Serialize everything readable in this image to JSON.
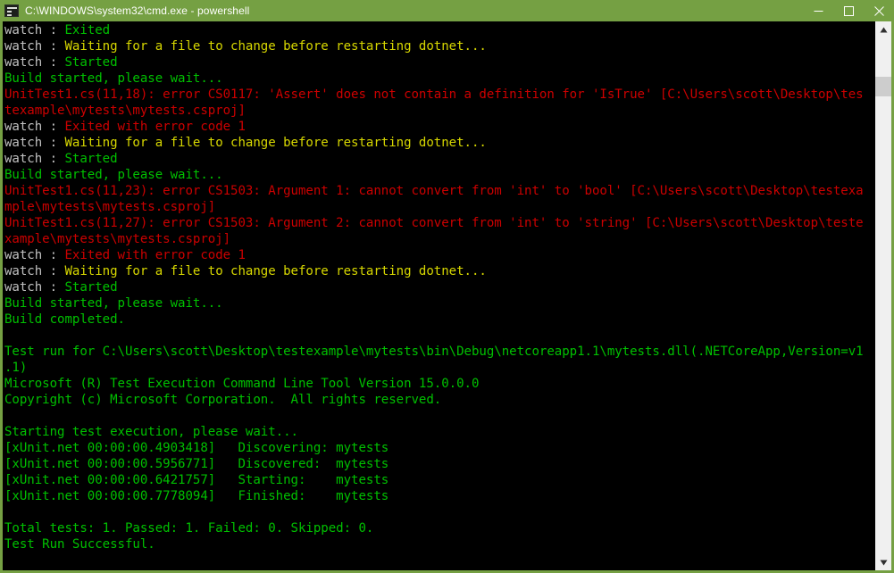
{
  "window": {
    "title": "C:\\WINDOWS\\system32\\cmd.exe - powershell",
    "icon": "cmd-console-icon",
    "titlebar_color": "#75a043",
    "console_bg": "#000000"
  },
  "controls": {
    "minimize_label": "Minimize",
    "maximize_label": "Maximize",
    "close_label": "Close"
  },
  "scrollbar": {
    "up_arrow_label": "Scroll up",
    "down_arrow_label": "Scroll down",
    "thumb_label": "Scroll thumb"
  },
  "colors": {
    "green": "#00c000",
    "red": "#cc0000",
    "yellow": "#d7d700",
    "gray": "#c0c0c0",
    "accent": "#75a043"
  },
  "console": {
    "lines": [
      [
        {
          "t": "watch : ",
          "c": "gray"
        },
        {
          "t": "Exited",
          "c": "green"
        }
      ],
      [
        {
          "t": "watch : ",
          "c": "gray"
        },
        {
          "t": "Waiting for a file to change before restarting dotnet...",
          "c": "yellow"
        }
      ],
      [
        {
          "t": "watch : ",
          "c": "gray"
        },
        {
          "t": "Started",
          "c": "green"
        }
      ],
      [
        {
          "t": "Build started, please wait...",
          "c": "green"
        }
      ],
      [
        {
          "t": "UnitTest1.cs(11,18): error CS0117: 'Assert' does not contain a definition for 'IsTrue' [C:\\Users\\scott\\Desktop\\tes",
          "c": "red"
        }
      ],
      [
        {
          "t": "texample\\mytests\\mytests.csproj]",
          "c": "red"
        }
      ],
      [
        {
          "t": "watch : ",
          "c": "gray"
        },
        {
          "t": "Exited with error code 1",
          "c": "red"
        }
      ],
      [
        {
          "t": "watch : ",
          "c": "gray"
        },
        {
          "t": "Waiting for a file to change before restarting dotnet...",
          "c": "yellow"
        }
      ],
      [
        {
          "t": "watch : ",
          "c": "gray"
        },
        {
          "t": "Started",
          "c": "green"
        }
      ],
      [
        {
          "t": "Build started, please wait...",
          "c": "green"
        }
      ],
      [
        {
          "t": "UnitTest1.cs(11,23): error CS1503: Argument 1: cannot convert from 'int' to 'bool' [C:\\Users\\scott\\Desktop\\testexa",
          "c": "red"
        }
      ],
      [
        {
          "t": "mple\\mytests\\mytests.csproj]",
          "c": "red"
        }
      ],
      [
        {
          "t": "UnitTest1.cs(11,27): error CS1503: Argument 2: cannot convert from 'int' to 'string' [C:\\Users\\scott\\Desktop\\teste",
          "c": "red"
        }
      ],
      [
        {
          "t": "xample\\mytests\\mytests.csproj]",
          "c": "red"
        }
      ],
      [
        {
          "t": "watch : ",
          "c": "gray"
        },
        {
          "t": "Exited with error code 1",
          "c": "red"
        }
      ],
      [
        {
          "t": "watch : ",
          "c": "gray"
        },
        {
          "t": "Waiting for a file to change before restarting dotnet...",
          "c": "yellow"
        }
      ],
      [
        {
          "t": "watch : ",
          "c": "gray"
        },
        {
          "t": "Started",
          "c": "green"
        }
      ],
      [
        {
          "t": "Build started, please wait...",
          "c": "green"
        }
      ],
      [
        {
          "t": "Build completed.",
          "c": "green"
        }
      ],
      [
        {
          "t": "",
          "c": "green"
        }
      ],
      [
        {
          "t": "Test run for C:\\Users\\scott\\Desktop\\testexample\\mytests\\bin\\Debug\\netcoreapp1.1\\mytests.dll(.NETCoreApp,Version=v1",
          "c": "green"
        }
      ],
      [
        {
          "t": ".1)",
          "c": "green"
        }
      ],
      [
        {
          "t": "Microsoft (R) Test Execution Command Line Tool Version 15.0.0.0",
          "c": "green"
        }
      ],
      [
        {
          "t": "Copyright (c) Microsoft Corporation.  All rights reserved.",
          "c": "green"
        }
      ],
      [
        {
          "t": "",
          "c": "green"
        }
      ],
      [
        {
          "t": "Starting test execution, please wait...",
          "c": "green"
        }
      ],
      [
        {
          "t": "[xUnit.net 00:00:00.4903418]   Discovering: mytests",
          "c": "green"
        }
      ],
      [
        {
          "t": "[xUnit.net 00:00:00.5956771]   Discovered:  mytests",
          "c": "green"
        }
      ],
      [
        {
          "t": "[xUnit.net 00:00:00.6421757]   Starting:    mytests",
          "c": "green"
        }
      ],
      [
        {
          "t": "[xUnit.net 00:00:00.7778094]   Finished:    mytests",
          "c": "green"
        }
      ],
      [
        {
          "t": "",
          "c": "green"
        }
      ],
      [
        {
          "t": "Total tests: 1. Passed: 1. Failed: 0. Skipped: 0.",
          "c": "green"
        }
      ],
      [
        {
          "t": "Test Run Successful.",
          "c": "green"
        }
      ]
    ]
  }
}
